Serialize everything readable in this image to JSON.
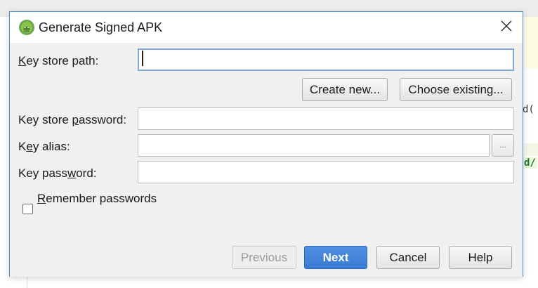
{
  "background": {
    "code_line_1": "d(",
    "code_line_2": "d/"
  },
  "dialog": {
    "title": "Generate Signed APK",
    "icons": {
      "app": "android-studio-icon",
      "close": "close-icon",
      "more": "ellipsis-icon"
    },
    "colors": {
      "primary": "#3a7bd5",
      "dialog_border": "#4d8fd6",
      "focus": "#7fa9d9"
    },
    "fields": {
      "key_store_path": {
        "label_pre": "",
        "label_ul": "K",
        "label_post": "ey store path:",
        "value": ""
      },
      "key_store_password": {
        "label_pre": "Key store ",
        "label_ul": "p",
        "label_post": "assword:",
        "value": ""
      },
      "key_alias": {
        "label_pre": "K",
        "label_ul": "e",
        "label_post": "y alias:",
        "value": ""
      },
      "key_password": {
        "label_pre": "Key pass",
        "label_ul": "w",
        "label_post": "ord:",
        "value": ""
      }
    },
    "buttons": {
      "create_new": "Create new...",
      "choose_existing": "Choose existing...",
      "browse_alias": "...",
      "previous": "Previous",
      "next": "Next",
      "cancel": "Cancel",
      "help": "Help"
    },
    "remember": {
      "label_ul": "R",
      "label_post": "emember passwords",
      "checked": false
    }
  }
}
